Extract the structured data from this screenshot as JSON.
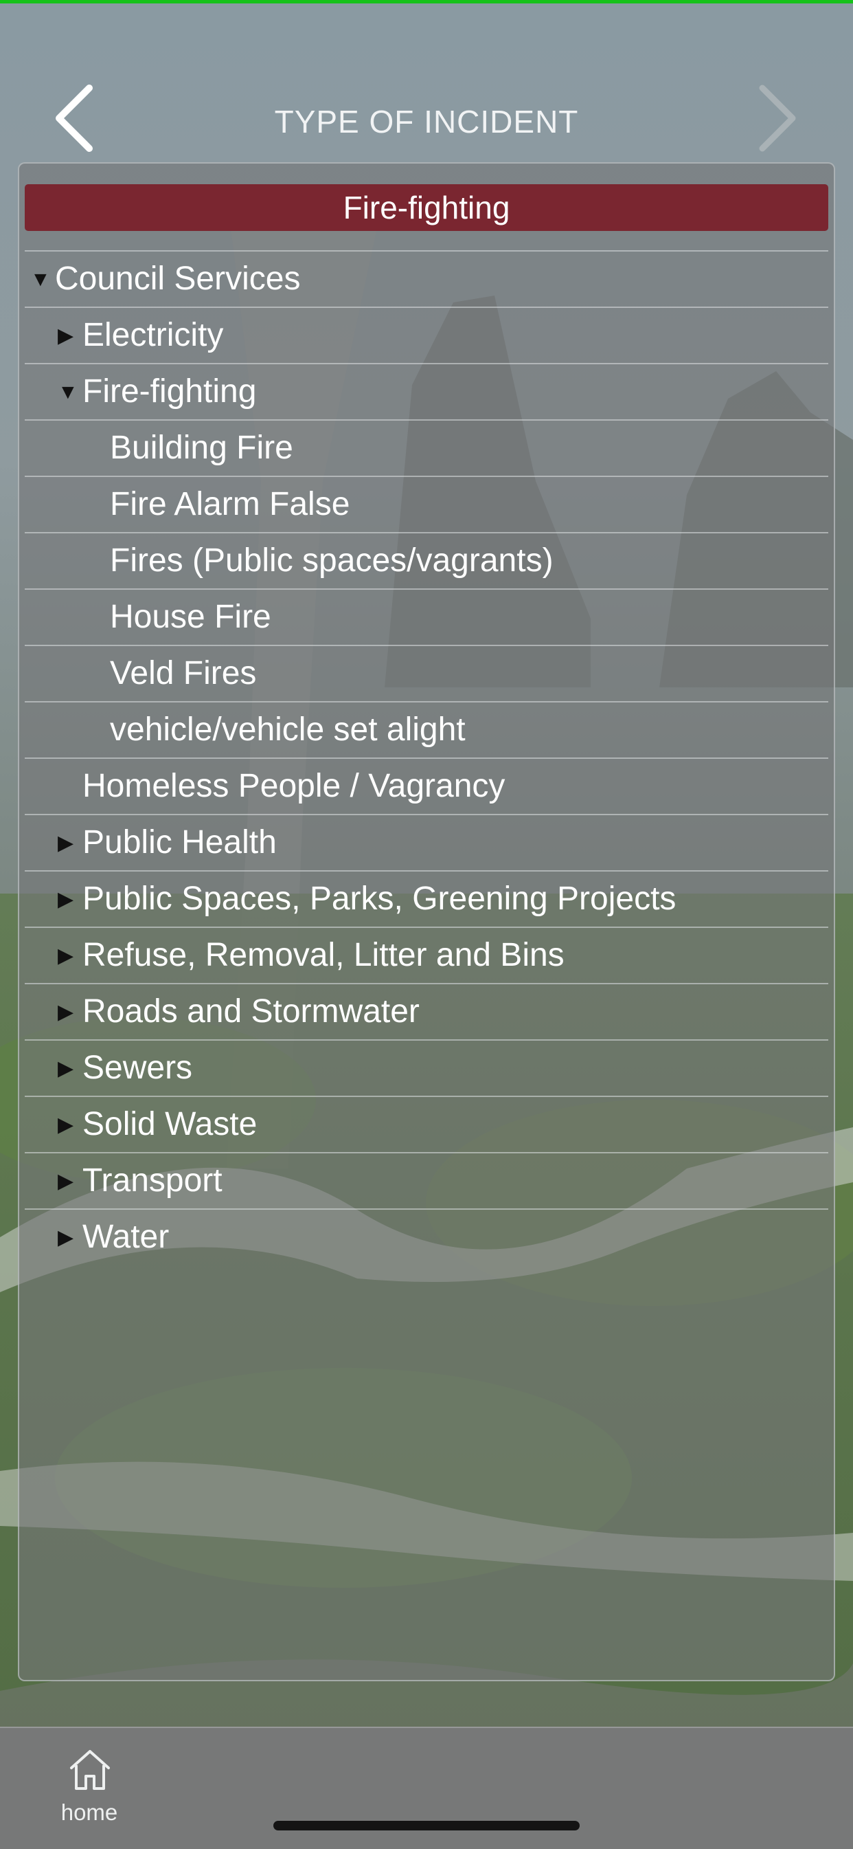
{
  "header": {
    "title": "TYPE OF INCIDENT",
    "back_icon": "chevron-left-icon",
    "forward_icon": "chevron-right-icon"
  },
  "selection": {
    "label": "Fire-fighting",
    "color": "#7a2630"
  },
  "tree": [
    {
      "name": "tree-item-council-services",
      "label": "Council Services",
      "level": 0,
      "state": "expanded"
    },
    {
      "name": "tree-item-electricity",
      "label": "Electricity",
      "level": 1,
      "state": "collapsed"
    },
    {
      "name": "tree-item-fire-fighting",
      "label": "Fire-fighting",
      "level": 1,
      "state": "expanded"
    },
    {
      "name": "tree-item-building-fire",
      "label": "Building Fire",
      "level": 2,
      "state": "leaf"
    },
    {
      "name": "tree-item-fire-alarm-false",
      "label": "Fire Alarm False",
      "level": 2,
      "state": "leaf"
    },
    {
      "name": "tree-item-fires-public-spaces",
      "label": "Fires (Public spaces/vagrants)",
      "level": 2,
      "state": "leaf"
    },
    {
      "name": "tree-item-house-fire",
      "label": "House Fire",
      "level": 2,
      "state": "leaf"
    },
    {
      "name": "tree-item-veld-fires",
      "label": "Veld Fires",
      "level": 2,
      "state": "leaf"
    },
    {
      "name": "tree-item-vehicle-set-alight",
      "label": "vehicle/vehicle set alight",
      "level": 2,
      "state": "leaf"
    },
    {
      "name": "tree-item-homeless-people",
      "label": "Homeless People / Vagrancy",
      "level": 1,
      "state": "leaf"
    },
    {
      "name": "tree-item-public-health",
      "label": "Public Health",
      "level": 1,
      "state": "collapsed"
    },
    {
      "name": "tree-item-public-spaces-parks",
      "label": "Public Spaces, Parks, Greening Projects",
      "level": 1,
      "state": "collapsed"
    },
    {
      "name": "tree-item-refuse-removal",
      "label": "Refuse, Removal, Litter and Bins",
      "level": 1,
      "state": "collapsed"
    },
    {
      "name": "tree-item-roads-stormwater",
      "label": "Roads and Stormwater",
      "level": 1,
      "state": "collapsed"
    },
    {
      "name": "tree-item-sewers",
      "label": "Sewers",
      "level": 1,
      "state": "collapsed"
    },
    {
      "name": "tree-item-solid-waste",
      "label": "Solid Waste",
      "level": 1,
      "state": "collapsed"
    },
    {
      "name": "tree-item-transport",
      "label": "Transport",
      "level": 1,
      "state": "collapsed"
    },
    {
      "name": "tree-item-water",
      "label": "Water",
      "level": 1,
      "state": "collapsed"
    }
  ],
  "glyphs": {
    "expanded": "▼",
    "collapsed": "▶"
  },
  "bottom_nav": {
    "home_label": "home",
    "home_icon": "home-icon"
  },
  "colors": {
    "status_line": "#16c21b",
    "selection": "#7a2630"
  }
}
